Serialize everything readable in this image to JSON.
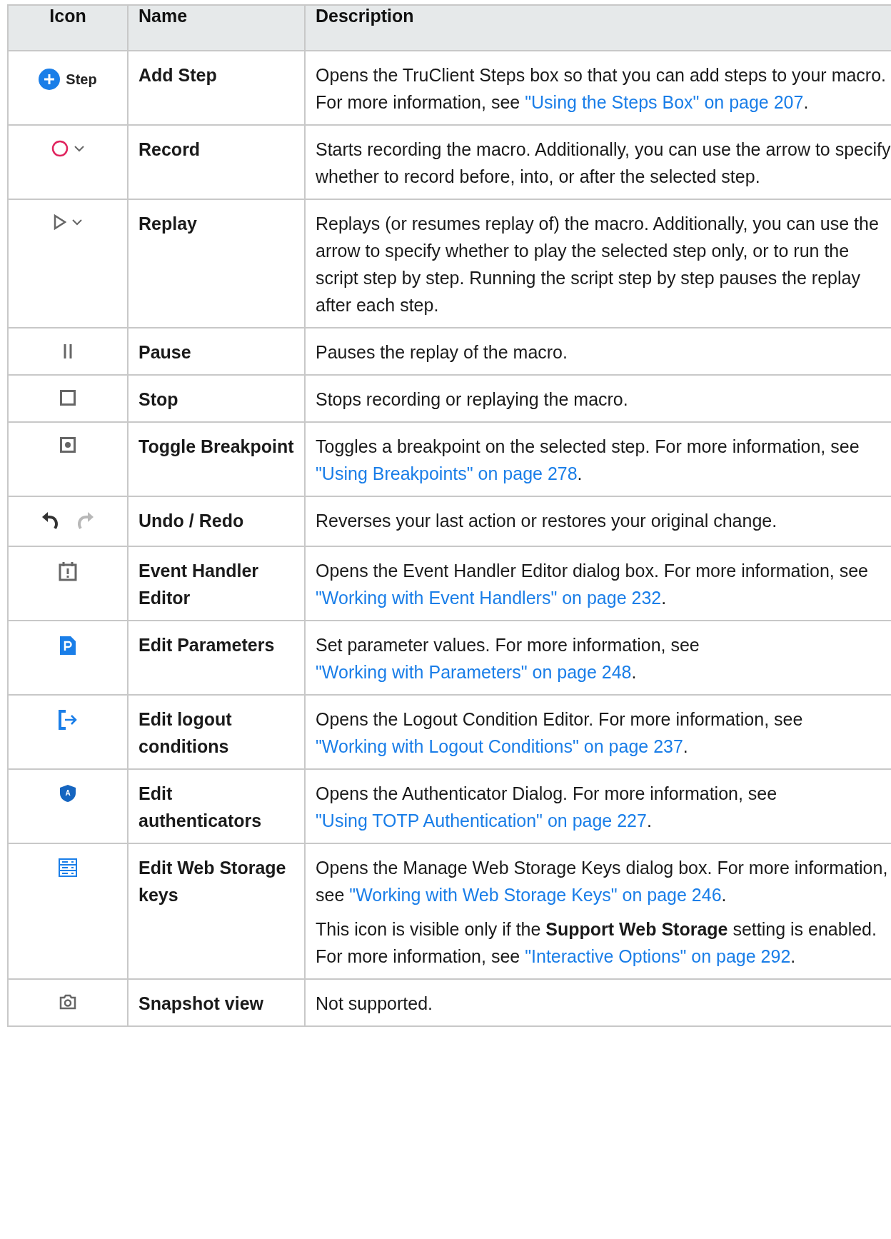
{
  "table": {
    "columns": [
      "Icon",
      "Name",
      "Description"
    ],
    "rows": [
      {
        "icon": {
          "kind": "add_step",
          "label": "Step"
        },
        "name": "Add Step",
        "description": [
          [
            {
              "kind": "text",
              "text": "Opens the TruClient Steps box so that you can add steps to your macro. For more information, see "
            },
            {
              "kind": "link",
              "text": "\"Using the Steps Box\" on page 207"
            },
            {
              "kind": "text",
              "text": "."
            }
          ]
        ]
      },
      {
        "icon": {
          "kind": "record"
        },
        "name": "Record",
        "description": [
          [
            {
              "kind": "text",
              "text": "Starts recording the macro. Additionally, you can use the arrow to specify whether to record before, into, or after the selected step."
            }
          ]
        ]
      },
      {
        "icon": {
          "kind": "replay"
        },
        "name": "Replay",
        "description": [
          [
            {
              "kind": "text",
              "text": "Replays (or resumes replay of) the macro. Additionally, you can use the arrow to specify whether to play the selected step only, or to run the script step by step. Running the script step by step pauses the replay after each step."
            }
          ]
        ]
      },
      {
        "icon": {
          "kind": "pause"
        },
        "name": "Pause",
        "description": [
          [
            {
              "kind": "text",
              "text": "Pauses the replay of the macro."
            }
          ]
        ]
      },
      {
        "icon": {
          "kind": "stop"
        },
        "name": "Stop",
        "description": [
          [
            {
              "kind": "text",
              "text": "Stops recording or replaying the macro."
            }
          ]
        ]
      },
      {
        "icon": {
          "kind": "breakpoint"
        },
        "name": "Toggle Breakpoint",
        "description": [
          [
            {
              "kind": "text",
              "text": "Toggles a breakpoint on the selected step. For more information, see "
            },
            {
              "kind": "link",
              "text": "\"Using Breakpoints\" on page 278"
            },
            {
              "kind": "text",
              "text": "."
            }
          ]
        ]
      },
      {
        "icon": {
          "kind": "undo_redo"
        },
        "name": "Undo / Redo",
        "description": [
          [
            {
              "kind": "text",
              "text": "Reverses your last action or restores your original change."
            }
          ]
        ]
      },
      {
        "icon": {
          "kind": "event"
        },
        "name": "Event Handler Editor",
        "description": [
          [
            {
              "kind": "text",
              "text": "Opens the Event Handler Editor dialog box. For more information, see "
            },
            {
              "kind": "link",
              "text": "\"Working with Event Handlers\" on page 232"
            },
            {
              "kind": "text",
              "text": "."
            }
          ]
        ]
      },
      {
        "icon": {
          "kind": "parameters"
        },
        "name": "Edit Parameters",
        "description": [
          [
            {
              "kind": "text",
              "text": "Set parameter values. For more information, see "
            },
            {
              "kind": "link",
              "text": "\"Working with Parameters\" on page 248"
            },
            {
              "kind": "text",
              "text": "."
            }
          ]
        ]
      },
      {
        "icon": {
          "kind": "logout"
        },
        "name": "Edit logout conditions",
        "description": [
          [
            {
              "kind": "text",
              "text": "Opens the Logout Condition Editor. For more information, see "
            },
            {
              "kind": "link",
              "text": "\"Working with Logout Conditions\" on page 237"
            },
            {
              "kind": "text",
              "text": "."
            }
          ]
        ]
      },
      {
        "icon": {
          "kind": "shield",
          "label": "A"
        },
        "name": "Edit authenticators",
        "description": [
          [
            {
              "kind": "text",
              "text": "Opens the Authenticator Dialog. For more information, see "
            },
            {
              "kind": "link",
              "text": "\"Using TOTP Authentication\" on page 227"
            },
            {
              "kind": "text",
              "text": "."
            }
          ]
        ]
      },
      {
        "icon": {
          "kind": "storage"
        },
        "name": "Edit Web Storage keys",
        "description": [
          [
            {
              "kind": "text",
              "text": "Opens the Manage Web Storage Keys dialog box. For more information, see "
            },
            {
              "kind": "link",
              "text": "\"Working with Web Storage Keys\" on page 246"
            },
            {
              "kind": "text",
              "text": "."
            }
          ],
          [
            {
              "kind": "text",
              "text": "This icon is visible only if the **Support Web Storage** setting is enabled. For more information, see "
            },
            {
              "kind": "link",
              "text": "\"Interactive Options\" on page 292"
            },
            {
              "kind": "text",
              "text": "."
            }
          ]
        ]
      },
      {
        "icon": {
          "kind": "snapshot"
        },
        "name": "Snapshot view",
        "description": [
          [
            {
              "kind": "text",
              "text": "Not supported."
            }
          ]
        ]
      }
    ]
  }
}
